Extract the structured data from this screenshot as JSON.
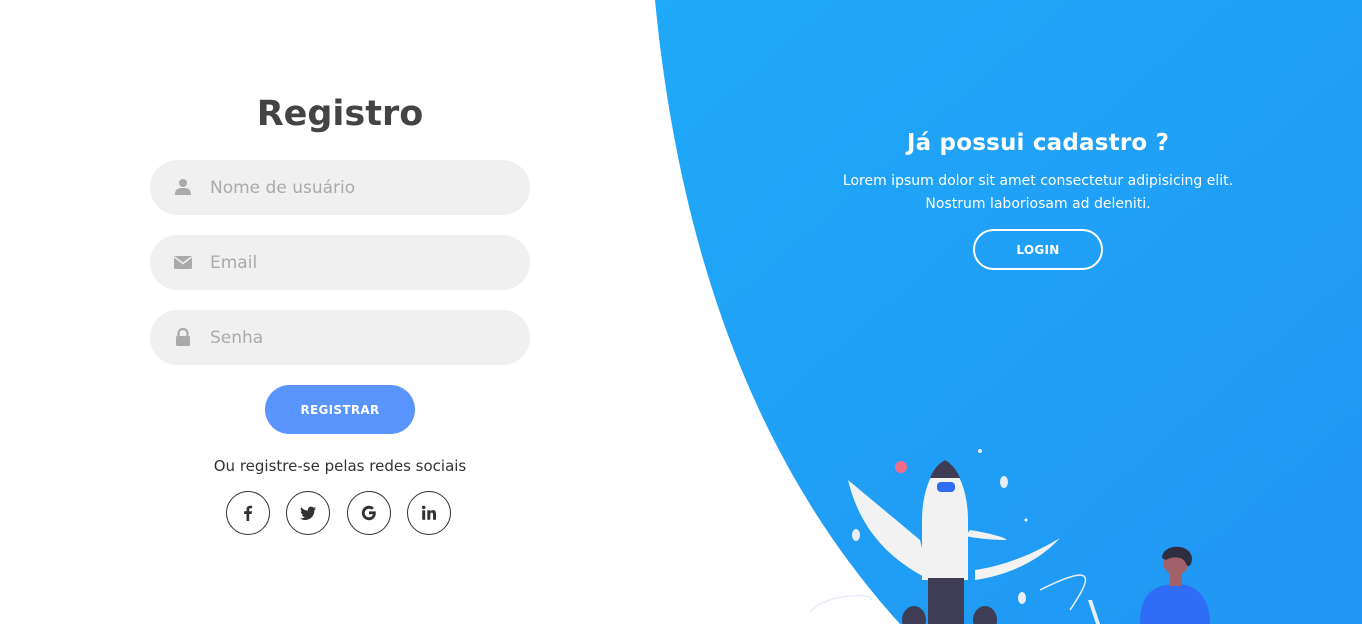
{
  "register_form": {
    "title": "Registro",
    "username_placeholder": "Nome de usuário",
    "email_placeholder": "Email",
    "password_placeholder": "Senha",
    "submit_label": "REGISTRAR",
    "social_text": "Ou registre-se pelas redes sociais",
    "social_icons": [
      "facebook-icon",
      "twitter-icon",
      "google-icon",
      "linkedin-icon"
    ]
  },
  "side_panel": {
    "heading": "Já possui cadastro ?",
    "text_line1": "Lorem ipsum dolor sit amet consectetur adipisicing elit.",
    "text_line2": "Nostrum laboriosam ad deleniti.",
    "login_label": "LOGIN"
  },
  "colors": {
    "accent": "#5995fd",
    "panel_gradient_start": "#1fa9f8",
    "panel_gradient_end": "#2196f3",
    "input_bg": "#f0f0f0",
    "title_text": "#444444"
  }
}
